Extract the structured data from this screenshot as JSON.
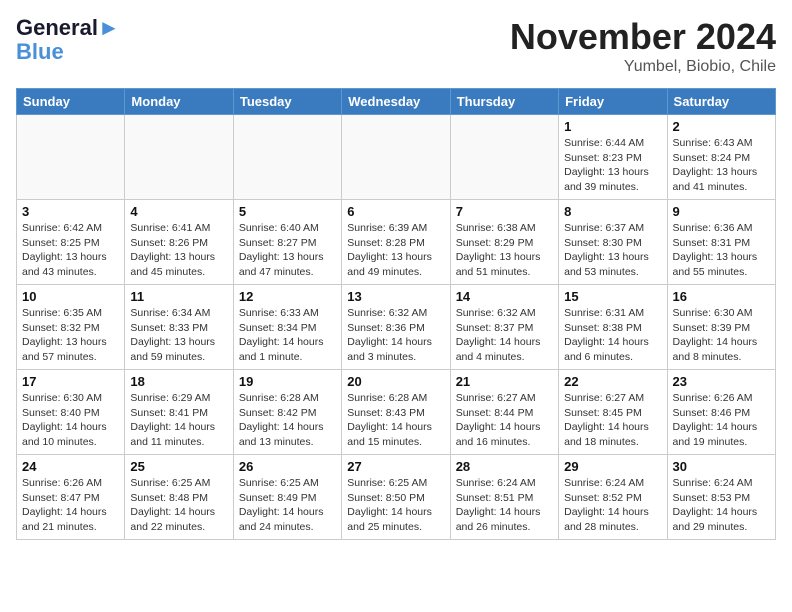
{
  "header": {
    "logo_line1": "General",
    "logo_line2": "Blue",
    "month_title": "November 2024",
    "location": "Yumbel, Biobio, Chile"
  },
  "weekdays": [
    "Sunday",
    "Monday",
    "Tuesday",
    "Wednesday",
    "Thursday",
    "Friday",
    "Saturday"
  ],
  "weeks": [
    [
      {
        "day": "",
        "info": ""
      },
      {
        "day": "",
        "info": ""
      },
      {
        "day": "",
        "info": ""
      },
      {
        "day": "",
        "info": ""
      },
      {
        "day": "",
        "info": ""
      },
      {
        "day": "1",
        "info": "Sunrise: 6:44 AM\nSunset: 8:23 PM\nDaylight: 13 hours\nand 39 minutes."
      },
      {
        "day": "2",
        "info": "Sunrise: 6:43 AM\nSunset: 8:24 PM\nDaylight: 13 hours\nand 41 minutes."
      }
    ],
    [
      {
        "day": "3",
        "info": "Sunrise: 6:42 AM\nSunset: 8:25 PM\nDaylight: 13 hours\nand 43 minutes."
      },
      {
        "day": "4",
        "info": "Sunrise: 6:41 AM\nSunset: 8:26 PM\nDaylight: 13 hours\nand 45 minutes."
      },
      {
        "day": "5",
        "info": "Sunrise: 6:40 AM\nSunset: 8:27 PM\nDaylight: 13 hours\nand 47 minutes."
      },
      {
        "day": "6",
        "info": "Sunrise: 6:39 AM\nSunset: 8:28 PM\nDaylight: 13 hours\nand 49 minutes."
      },
      {
        "day": "7",
        "info": "Sunrise: 6:38 AM\nSunset: 8:29 PM\nDaylight: 13 hours\nand 51 minutes."
      },
      {
        "day": "8",
        "info": "Sunrise: 6:37 AM\nSunset: 8:30 PM\nDaylight: 13 hours\nand 53 minutes."
      },
      {
        "day": "9",
        "info": "Sunrise: 6:36 AM\nSunset: 8:31 PM\nDaylight: 13 hours\nand 55 minutes."
      }
    ],
    [
      {
        "day": "10",
        "info": "Sunrise: 6:35 AM\nSunset: 8:32 PM\nDaylight: 13 hours\nand 57 minutes."
      },
      {
        "day": "11",
        "info": "Sunrise: 6:34 AM\nSunset: 8:33 PM\nDaylight: 13 hours\nand 59 minutes."
      },
      {
        "day": "12",
        "info": "Sunrise: 6:33 AM\nSunset: 8:34 PM\nDaylight: 14 hours\nand 1 minute."
      },
      {
        "day": "13",
        "info": "Sunrise: 6:32 AM\nSunset: 8:36 PM\nDaylight: 14 hours\nand 3 minutes."
      },
      {
        "day": "14",
        "info": "Sunrise: 6:32 AM\nSunset: 8:37 PM\nDaylight: 14 hours\nand 4 minutes."
      },
      {
        "day": "15",
        "info": "Sunrise: 6:31 AM\nSunset: 8:38 PM\nDaylight: 14 hours\nand 6 minutes."
      },
      {
        "day": "16",
        "info": "Sunrise: 6:30 AM\nSunset: 8:39 PM\nDaylight: 14 hours\nand 8 minutes."
      }
    ],
    [
      {
        "day": "17",
        "info": "Sunrise: 6:30 AM\nSunset: 8:40 PM\nDaylight: 14 hours\nand 10 minutes."
      },
      {
        "day": "18",
        "info": "Sunrise: 6:29 AM\nSunset: 8:41 PM\nDaylight: 14 hours\nand 11 minutes."
      },
      {
        "day": "19",
        "info": "Sunrise: 6:28 AM\nSunset: 8:42 PM\nDaylight: 14 hours\nand 13 minutes."
      },
      {
        "day": "20",
        "info": "Sunrise: 6:28 AM\nSunset: 8:43 PM\nDaylight: 14 hours\nand 15 minutes."
      },
      {
        "day": "21",
        "info": "Sunrise: 6:27 AM\nSunset: 8:44 PM\nDaylight: 14 hours\nand 16 minutes."
      },
      {
        "day": "22",
        "info": "Sunrise: 6:27 AM\nSunset: 8:45 PM\nDaylight: 14 hours\nand 18 minutes."
      },
      {
        "day": "23",
        "info": "Sunrise: 6:26 AM\nSunset: 8:46 PM\nDaylight: 14 hours\nand 19 minutes."
      }
    ],
    [
      {
        "day": "24",
        "info": "Sunrise: 6:26 AM\nSunset: 8:47 PM\nDaylight: 14 hours\nand 21 minutes."
      },
      {
        "day": "25",
        "info": "Sunrise: 6:25 AM\nSunset: 8:48 PM\nDaylight: 14 hours\nand 22 minutes."
      },
      {
        "day": "26",
        "info": "Sunrise: 6:25 AM\nSunset: 8:49 PM\nDaylight: 14 hours\nand 24 minutes."
      },
      {
        "day": "27",
        "info": "Sunrise: 6:25 AM\nSunset: 8:50 PM\nDaylight: 14 hours\nand 25 minutes."
      },
      {
        "day": "28",
        "info": "Sunrise: 6:24 AM\nSunset: 8:51 PM\nDaylight: 14 hours\nand 26 minutes."
      },
      {
        "day": "29",
        "info": "Sunrise: 6:24 AM\nSunset: 8:52 PM\nDaylight: 14 hours\nand 28 minutes."
      },
      {
        "day": "30",
        "info": "Sunrise: 6:24 AM\nSunset: 8:53 PM\nDaylight: 14 hours\nand 29 minutes."
      }
    ]
  ]
}
